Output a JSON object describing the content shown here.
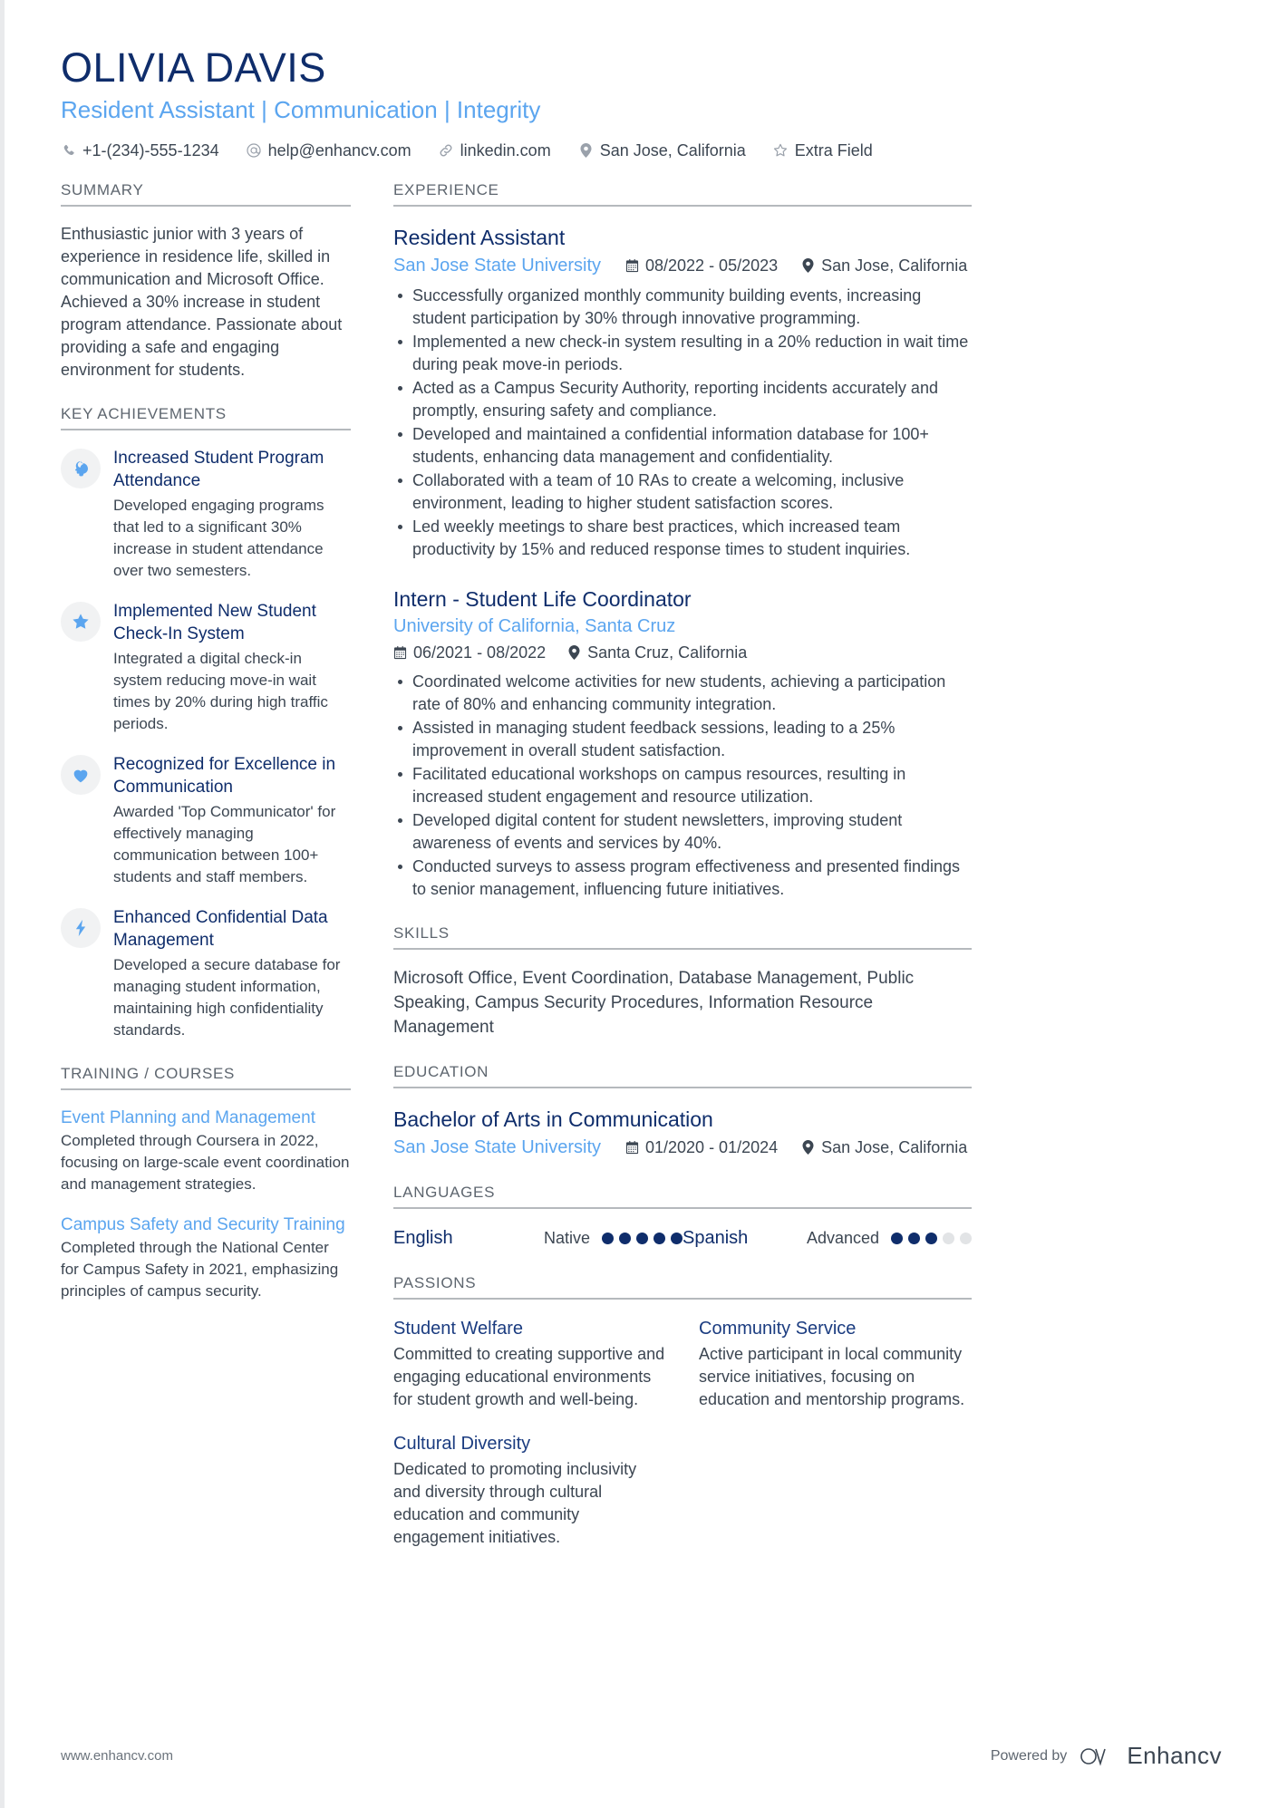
{
  "header": {
    "name": "OLIVIA DAVIS",
    "headline": "Resident Assistant | Communication | Integrity",
    "contacts": [
      {
        "icon": "phone-icon",
        "text": "+1-(234)-555-1234"
      },
      {
        "icon": "email-icon",
        "text": "help@enhancv.com"
      },
      {
        "icon": "link-icon",
        "text": "linkedin.com"
      },
      {
        "icon": "location-pin-icon",
        "text": "San Jose, California"
      },
      {
        "icon": "star-outline-icon",
        "text": "Extra Field"
      }
    ]
  },
  "summary": {
    "title": "SUMMARY",
    "text": "Enthusiastic junior with 3 years of experience in residence life, skilled in communication and Microsoft Office. Achieved a 30% increase in student program attendance. Passionate about providing a safe and engaging environment for students."
  },
  "key_achievements": {
    "title": "KEY ACHIEVEMENTS",
    "items": [
      {
        "icon": "brain-head-icon",
        "title": "Increased Student Program Attendance",
        "desc": "Developed engaging programs that led to a significant 30% increase in student attendance over two semesters."
      },
      {
        "icon": "star-icon",
        "title": "Implemented New Student Check-In System",
        "desc": "Integrated a digital check-in system reducing move-in wait times by 20% during high traffic periods."
      },
      {
        "icon": "heart-icon",
        "title": "Recognized for Excellence in Communication",
        "desc": "Awarded 'Top Communicator' for effectively managing communication between 100+ students and staff members."
      },
      {
        "icon": "lightning-bolt-icon",
        "title": "Enhanced Confidential Data Management",
        "desc": "Developed a secure database for managing student information, maintaining high confidentiality standards."
      }
    ]
  },
  "training": {
    "title": "TRAINING / COURSES",
    "items": [
      {
        "title": "Event Planning and Management",
        "desc": "Completed through Coursera in 2022, focusing on large-scale event coordination and management strategies."
      },
      {
        "title": "Campus Safety and Security Training",
        "desc": "Completed through the National Center for Campus Safety in 2021, emphasizing principles of campus security."
      }
    ]
  },
  "experience": {
    "title": "EXPERIENCE",
    "jobs": [
      {
        "title": "Resident Assistant",
        "org": "San Jose State University",
        "dates": "08/2022 - 05/2023",
        "location": "San Jose, California",
        "layout": "inline",
        "bullets": [
          "Successfully organized monthly community building events, increasing student participation by 30% through innovative programming.",
          "Implemented a new check-in system resulting in a 20% reduction in wait time during peak move-in periods.",
          "Acted as a Campus Security Authority, reporting incidents accurately and promptly, ensuring safety and compliance.",
          "Developed and maintained a confidential information database for 100+ students, enhancing data management and confidentiality.",
          "Collaborated with a team of 10 RAs to create a welcoming, inclusive environment, leading to higher student satisfaction scores.",
          "Led weekly meetings to share best practices, which increased team productivity by 15% and reduced response times to student inquiries."
        ]
      },
      {
        "title": "Intern - Student Life Coordinator",
        "org": "University of California, Santa Cruz",
        "dates": "06/2021 - 08/2022",
        "location": "Santa Cruz, California",
        "layout": "stacked",
        "bullets": [
          "Coordinated welcome activities for new students, achieving a participation rate of 80% and enhancing community integration.",
          "Assisted in managing student feedback sessions, leading to a 25% improvement in overall student satisfaction.",
          "Facilitated educational workshops on campus resources, resulting in increased student engagement and resource utilization.",
          "Developed digital content for student newsletters, improving student awareness of events and services by 40%.",
          "Conducted surveys to assess program effectiveness and presented findings to senior management, influencing future initiatives."
        ]
      }
    ]
  },
  "skills": {
    "title": "SKILLS",
    "text": "Microsoft Office, Event Coordination, Database Management, Public Speaking, Campus Security Procedures, Information Resource Management"
  },
  "education": {
    "title": "EDUCATION",
    "degree": "Bachelor of Arts in Communication",
    "school": "San Jose State University",
    "dates": "01/2020 - 01/2024",
    "location": "San Jose, California"
  },
  "languages": {
    "title": "LANGUAGES",
    "items": [
      {
        "name": "English",
        "level": "Native",
        "filled": 5,
        "total": 5
      },
      {
        "name": "Spanish",
        "level": "Advanced",
        "filled": 3,
        "total": 5
      }
    ]
  },
  "passions": {
    "title": "PASSIONS",
    "items": [
      {
        "title": "Student Welfare",
        "desc": "Committed to creating supportive and engaging educational environments for student growth and well-being."
      },
      {
        "title": "Community Service",
        "desc": "Active participant in local community service initiatives, focusing on education and mentorship programs."
      },
      {
        "title": "Cultural Diversity",
        "desc": "Dedicated to promoting inclusivity and diversity through cultural education and community engagement initiatives."
      }
    ]
  },
  "footer": {
    "url": "www.enhancv.com",
    "powered_by": "Powered by",
    "brand": "Enhancv"
  },
  "colors": {
    "navy": "#0f2d6b",
    "light_blue": "#5ba5ef",
    "body_text": "#3c4652",
    "rule": "#b5b9bd",
    "badge_bg": "#f1f2f3",
    "dot_empty": "#e2e4e6"
  }
}
